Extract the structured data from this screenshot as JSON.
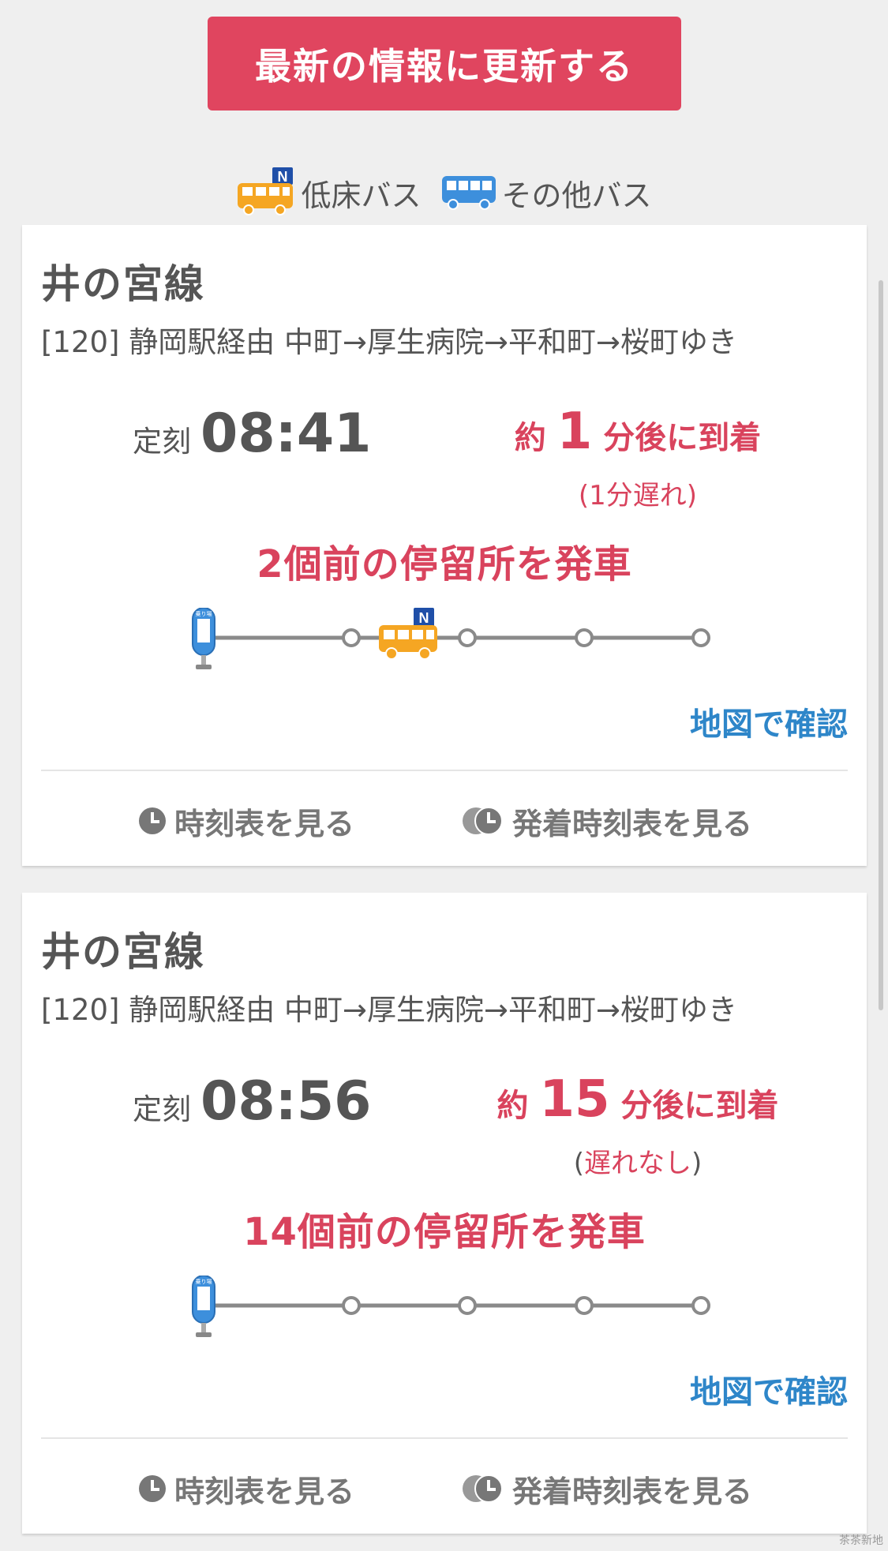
{
  "header": {
    "refresh_label": "最新の情報に更新する"
  },
  "legend": {
    "low_floor_label": "低床バス",
    "other_label": "その他バス",
    "low_floor_badge": "N"
  },
  "colors": {
    "accent_red": "#e0455f",
    "link_blue": "#2e86c9",
    "low_floor_bus": "#f5a623",
    "other_bus": "#3d8fdc"
  },
  "cards": [
    {
      "route_name": "井の宮線",
      "route_desc": "[120] 静岡駅経由 中町→厚生病院→平和町→桜町ゆき",
      "scheduled_label": "定刻",
      "scheduled_time": "08:41",
      "arrival_prefix": "約",
      "arrival_minutes": "1",
      "arrival_suffix": "分後に到着",
      "delay_text": "(1分遅れ)",
      "stops_before": "2個前の停留所を発車",
      "map_link": "地図で確認",
      "timetable_label": "時刻表を見る",
      "arrival_timetable_label": "発着時刻表を見る",
      "bus_badge": "N",
      "stop_sign_text": "乗り場"
    },
    {
      "route_name": "井の宮線",
      "route_desc": "[120] 静岡駅経由 中町→厚生病院→平和町→桜町ゆき",
      "scheduled_label": "定刻",
      "scheduled_time": "08:56",
      "arrival_prefix": "約",
      "arrival_minutes": "15",
      "arrival_suffix": "分後に到着",
      "delay_open": "(",
      "delay_text": "遅れなし",
      "delay_close": ")",
      "stops_before": "14個前の停留所を発車",
      "map_link": "地図で確認",
      "timetable_label": "時刻表を見る",
      "arrival_timetable_label": "発着時刻表を見る",
      "stop_sign_text": "乗り場"
    }
  ],
  "watermark": "茶茶新地"
}
